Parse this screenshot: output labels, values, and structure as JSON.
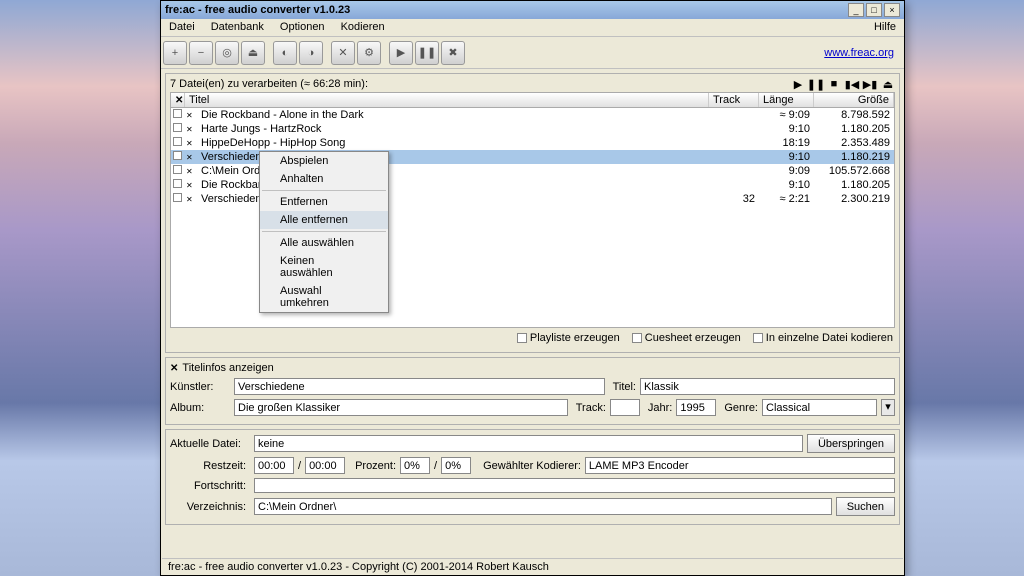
{
  "window": {
    "title": "fre:ac - free audio converter v1.0.23"
  },
  "menu": {
    "file": "Datei",
    "database": "Datenbank",
    "options": "Optionen",
    "encode": "Kodieren",
    "help": "Hilfe"
  },
  "link": {
    "url": "www.freac.org"
  },
  "filecount": {
    "text": "7 Datei(en) zu verarbeiten (≈ 66:28 min):"
  },
  "columns": {
    "title": "Titel",
    "track": "Track",
    "length": "Länge",
    "size": "Größe"
  },
  "rows": [
    {
      "title": "Die Rockband - Alone in the Dark",
      "track": "",
      "length": "≈ 9:09",
      "size": "8.798.592"
    },
    {
      "title": "Harte Jungs - HartzRock",
      "track": "",
      "length": "9:10",
      "size": "1.180.205"
    },
    {
      "title": "HippeDeHopp - HipHop Song",
      "track": "",
      "length": "18:19",
      "size": "2.353.489"
    },
    {
      "title": "Verschiedene - Kla",
      "track": "",
      "length": "9:10",
      "size": "1.180.219",
      "selected": true
    },
    {
      "title": "C:\\Mein Ordner\\M",
      "track": "",
      "length": "9:09",
      "size": "105.572.668"
    },
    {
      "title": "Die Rockband - R",
      "track": "",
      "length": "9:10",
      "size": "1.180.205"
    },
    {
      "title": "Verschiedene - Ku",
      "track": "32",
      "length": "≈ 2:21",
      "size": "2.300.219"
    }
  ],
  "context_menu": {
    "play": "Abspielen",
    "stop": "Anhalten",
    "remove": "Entfernen",
    "remove_all": "Alle entfernen",
    "select_all": "Alle auswählen",
    "select_none": "Keinen auswählen",
    "invert": "Auswahl umkehren"
  },
  "checkboxes": {
    "playlist": "Playliste erzeugen",
    "cuesheet": "Cuesheet erzeugen",
    "single_file": "In einzelne Datei kodieren"
  },
  "titleinfos": {
    "heading": "Titelinfos anzeigen",
    "artist_label": "Künstler:",
    "artist_value": "Verschiedene",
    "title_label": "Titel:",
    "title_value": "Klassik",
    "album_label": "Album:",
    "album_value": "Die großen Klassiker",
    "track_label": "Track:",
    "track_value": "",
    "year_label": "Jahr:",
    "year_value": "1995",
    "genre_label": "Genre:",
    "genre_value": "Classical"
  },
  "progress": {
    "current_file_label": "Aktuelle Datei:",
    "current_file_value": "keine",
    "skip": "Überspringen",
    "remaining_label": "Restzeit:",
    "time1": "00:00",
    "time_sep": "/",
    "time2": "00:00",
    "percent_label": "Prozent:",
    "percent1": "0%",
    "percent_sep": "/",
    "percent2": "0%",
    "encoder_label": "Gewählter Kodierer:",
    "encoder_value": "LAME MP3 Encoder",
    "progress_label": "Fortschritt:",
    "dir_label": "Verzeichnis:",
    "dir_value": "C:\\Mein Ordner\\",
    "search": "Suchen"
  },
  "statusbar": {
    "text": "fre:ac - free audio converter v1.0.23 - Copyright (C) 2001-2014 Robert Kausch"
  }
}
